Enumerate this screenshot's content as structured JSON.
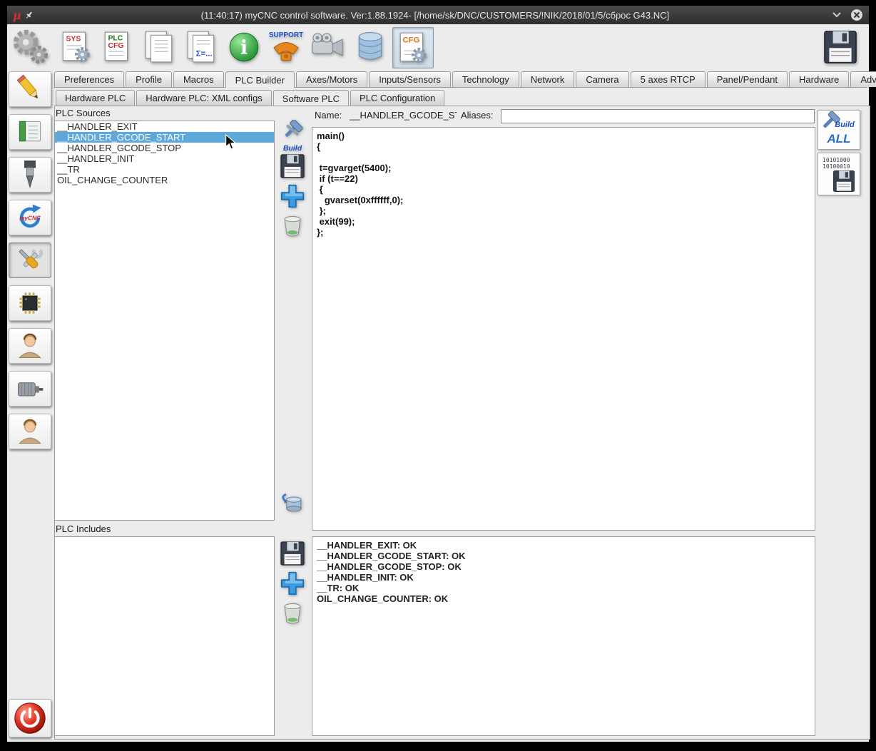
{
  "titlebar": {
    "app_glyph": "μ",
    "title": "(11:40:17) myCNC control software. Ver:1.88.1924- [/home/sk/DNC/CUSTOMERS/!NIK/2018/01/5/сброс G43.NC]"
  },
  "toolbar": {
    "sys_label": "SYS",
    "plc_label": "PLC",
    "plc_cfg_label": "CFG",
    "sigma_label": "Σ=...",
    "info_glyph": "i",
    "support_label": "SUPPORT",
    "cfg_label": "CFG"
  },
  "tabs": {
    "active": "PLC Builder",
    "items": [
      "Preferences",
      "Profile",
      "Macros",
      "PLC Builder",
      "Axes/Motors",
      "Inputs/Sensors",
      "Technology",
      "Network",
      "Camera",
      "5 axes RTCP",
      "Panel/Pendant",
      "Hardware",
      "Advanced"
    ]
  },
  "subtabs": {
    "active": "Software PLC",
    "items": [
      "Hardware PLC",
      "Hardware PLC: XML configs",
      "Software PLC",
      "PLC Configuration"
    ]
  },
  "sidebar": {
    "mycnc_label": "myCNC"
  },
  "plc_sources": {
    "label": "PLC Sources",
    "selected": "__HANDLER_GCODE_START",
    "items": [
      "__HANDLER_EXIT",
      "__HANDLER_GCODE_START",
      "__HANDLER_GCODE_STOP",
      "__HANDLER_INIT",
      "__TR",
      "OIL_CHANGE_COUNTER"
    ]
  },
  "editor_header": {
    "name_label": "Name:",
    "name_value": "__HANDLER_GCODE_START",
    "aliases_label": "Aliases:",
    "aliases_value": ""
  },
  "code_editor": {
    "code": "main()\n{\n\n t=gvarget(5400);\n if (t==22)\n {\n   gvarset(0xffffff,0);\n };\n exit(99);\n};"
  },
  "middle_toolbar": {
    "build_label": "Build"
  },
  "right_toolbar": {
    "build_label": "Build",
    "all_label": "ALL",
    "binary_line1": "10101000",
    "binary_line2": "10100010"
  },
  "plc_includes": {
    "label": "PLC Includes",
    "items": []
  },
  "build_log": {
    "lines": [
      "__HANDLER_EXIT: OK",
      "__HANDLER_GCODE_START: OK",
      "__HANDLER_GCODE_STOP: OK",
      "__HANDLER_INIT: OK",
      "__TR: OK",
      "OIL_CHANGE_COUNTER: OK"
    ]
  }
}
